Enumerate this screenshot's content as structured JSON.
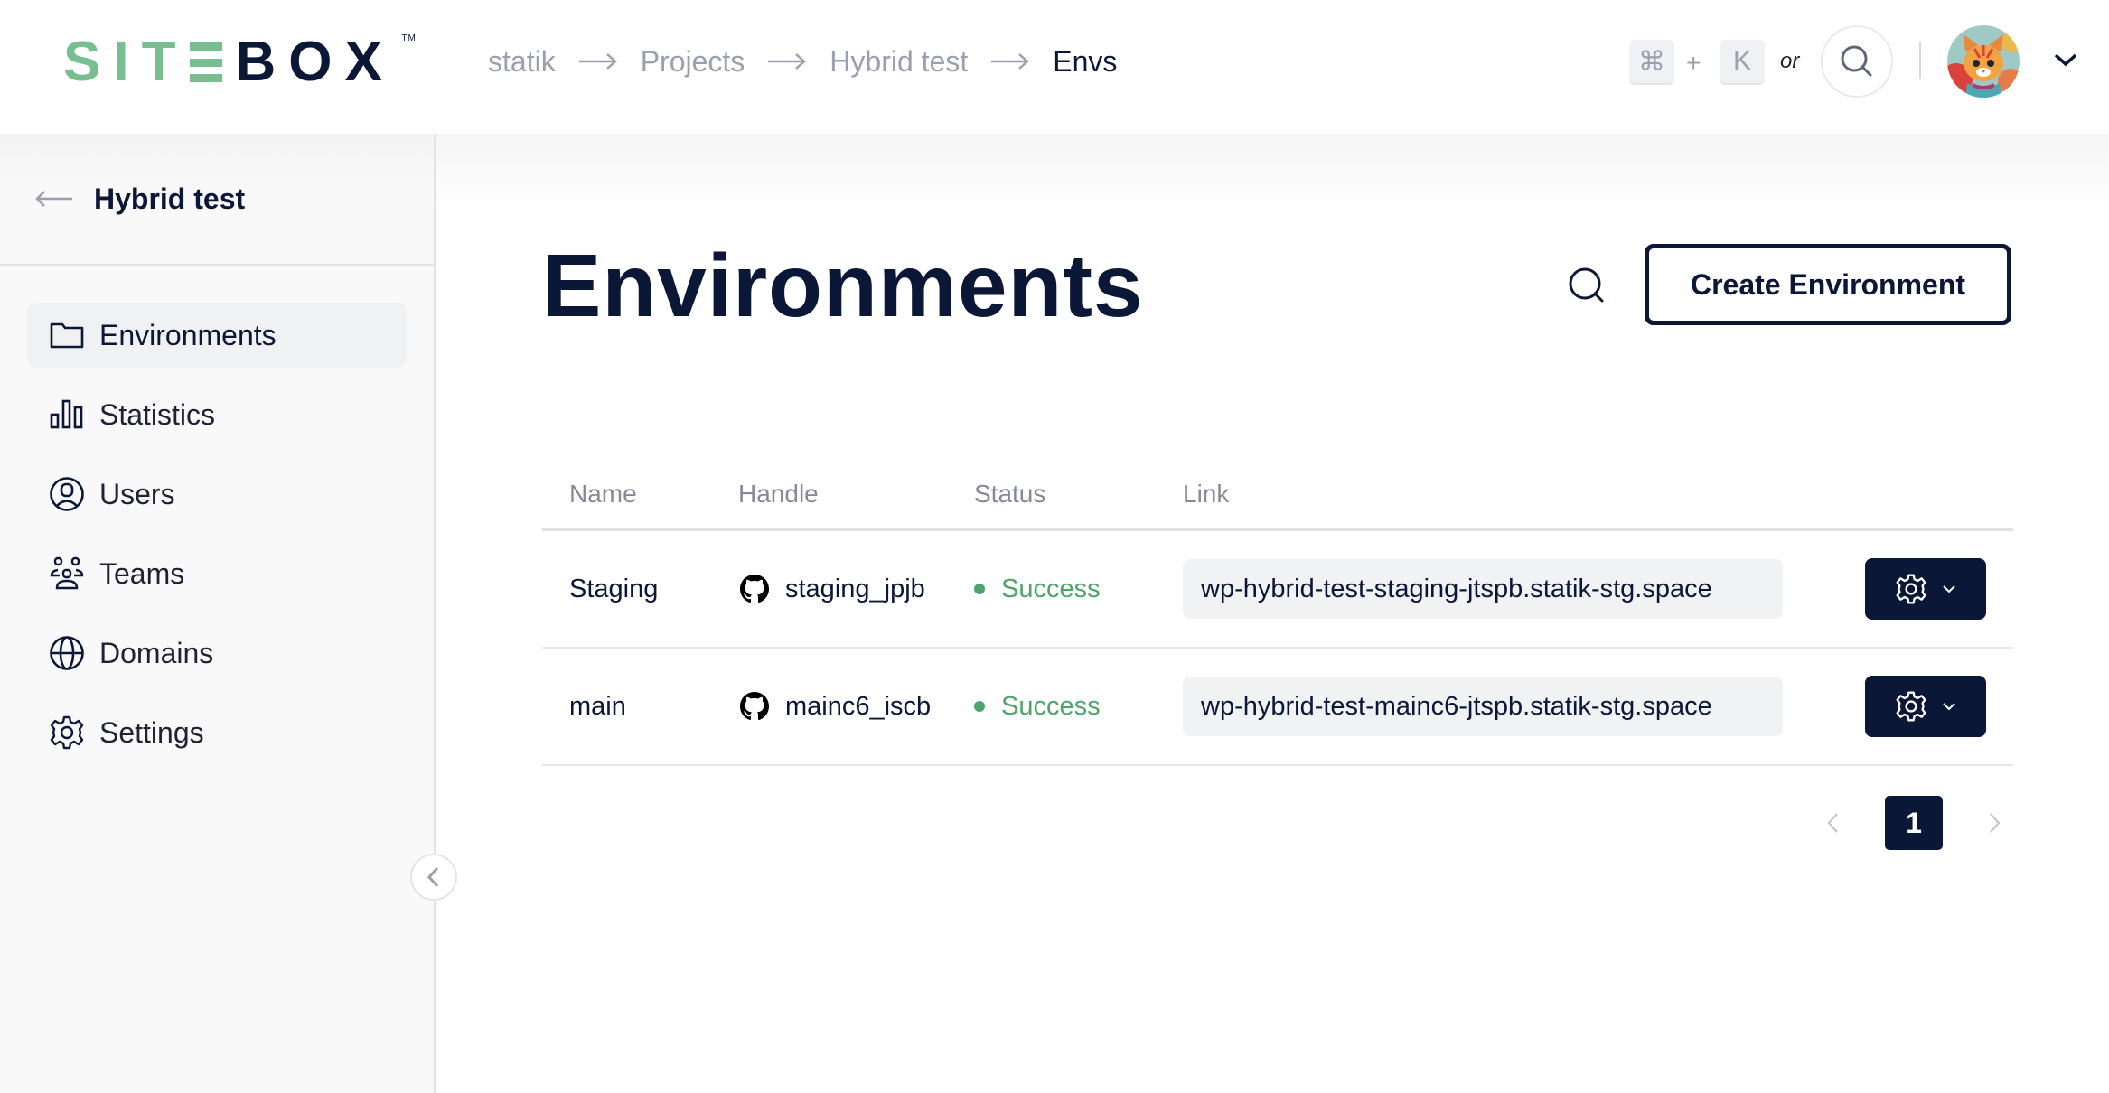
{
  "header": {
    "logo": {
      "part1": "SIT",
      "part2": "BOX",
      "trademark": "TM"
    },
    "breadcrumb": [
      {
        "label": "statik"
      },
      {
        "label": "Projects"
      },
      {
        "label": "Hybrid test"
      },
      {
        "label": "Envs",
        "current": true
      }
    ],
    "shortcut": {
      "key1": "⌘",
      "plus": "+",
      "key2": "K",
      "or": "or"
    },
    "icons": {
      "search": "search-icon",
      "avatar": "cat-avatar",
      "menu": "chevron-down-icon"
    }
  },
  "sidebar": {
    "back_label": "Hybrid test",
    "items": [
      {
        "label": "Environments",
        "icon": "folder-icon",
        "active": true
      },
      {
        "label": "Statistics",
        "icon": "bar-chart-icon"
      },
      {
        "label": "Users",
        "icon": "user-circle-icon"
      },
      {
        "label": "Teams",
        "icon": "team-icon"
      },
      {
        "label": "Domains",
        "icon": "globe-icon"
      },
      {
        "label": "Settings",
        "icon": "gear-icon"
      }
    ]
  },
  "main": {
    "title": "Environments",
    "create_button": "Create Environment",
    "table": {
      "columns": [
        "Name",
        "Handle",
        "Status",
        "Link"
      ],
      "rows": [
        {
          "name": "Staging",
          "handle": "staging_jpjb",
          "status": "Success",
          "link": "wp-hybrid-test-staging-jtspb.statik-stg.space"
        },
        {
          "name": "main",
          "handle": "mainc6_iscb",
          "status": "Success",
          "link": "wp-hybrid-test-mainc6-jtspb.statik-stg.space"
        }
      ]
    },
    "pagination": {
      "current_page": "1"
    }
  },
  "colors": {
    "brand_green": "#77bf91",
    "navy": "#0b1736",
    "success": "#4ea56b",
    "muted": "#9aa0ad"
  }
}
